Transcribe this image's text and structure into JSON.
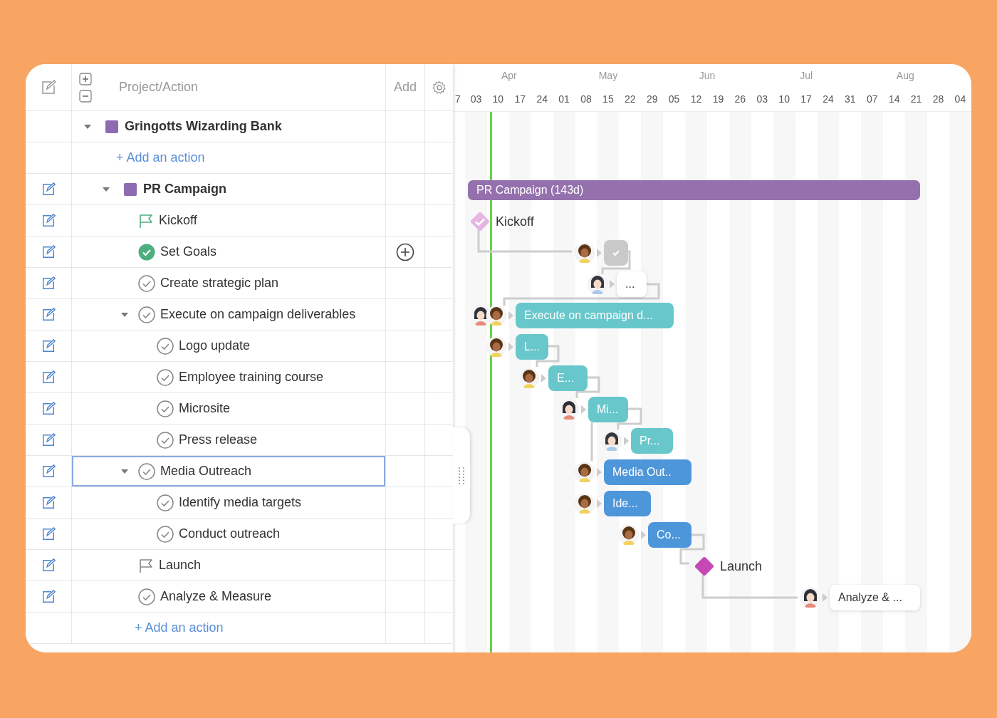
{
  "header": {
    "title": "Project/Action",
    "add": "Add"
  },
  "tree": [
    {
      "kind": "project",
      "label": "Gringotts Wizarding Bank",
      "color": "#8e6bb0",
      "expanded": true,
      "selected": false,
      "editable": false,
      "children": [
        {
          "kind": "add",
          "label": "+ Add an action"
        },
        {
          "kind": "project",
          "label": "PR Campaign",
          "color": "#8e6bb0",
          "expanded": true,
          "selected": false,
          "editable": true,
          "children": [
            {
              "kind": "milestone",
              "label": "Kickoff",
              "done": true,
              "selected": false,
              "editable": true
            },
            {
              "kind": "task",
              "label": "Set Goals",
              "done": true,
              "selected": false,
              "editable": true,
              "add_button": true
            },
            {
              "kind": "task",
              "label": "Create strategic plan",
              "done": false,
              "selected": false,
              "editable": true
            },
            {
              "kind": "task",
              "label": "Execute on campaign deliverables",
              "done": false,
              "expanded": true,
              "selected": false,
              "editable": true,
              "children": [
                {
                  "kind": "task",
                  "label": "Logo update",
                  "done": false,
                  "selected": false,
                  "editable": true
                },
                {
                  "kind": "task",
                  "label": "Employee training course",
                  "done": false,
                  "selected": false,
                  "editable": true
                },
                {
                  "kind": "task",
                  "label": "Microsite",
                  "done": false,
                  "selected": false,
                  "editable": true
                },
                {
                  "kind": "task",
                  "label": "Press release",
                  "done": false,
                  "selected": false,
                  "editable": true
                }
              ]
            },
            {
              "kind": "task",
              "label": "Media Outreach",
              "done": false,
              "expanded": true,
              "selected": true,
              "editable": true,
              "children": [
                {
                  "kind": "task",
                  "label": "Identify media targets",
                  "done": false,
                  "selected": false,
                  "editable": true
                },
                {
                  "kind": "task",
                  "label": "Conduct outreach",
                  "done": false,
                  "selected": false,
                  "editable": true
                }
              ]
            },
            {
              "kind": "milestone",
              "label": "Launch",
              "done": false,
              "selected": false,
              "editable": true
            },
            {
              "kind": "task",
              "label": "Analyze & Measure",
              "done": false,
              "selected": false,
              "editable": true
            },
            {
              "kind": "add",
              "label": "+ Add an action"
            }
          ]
        }
      ]
    }
  ],
  "timeline": {
    "lead_weeks": [
      "7"
    ],
    "months": [
      {
        "label": "Apr",
        "weeks": [
          "03",
          "10",
          "17",
          "24"
        ]
      },
      {
        "label": "May",
        "weeks": [
          "01",
          "08",
          "15",
          "22",
          "29"
        ]
      },
      {
        "label": "Jun",
        "weeks": [
          "05",
          "12",
          "19",
          "26"
        ]
      },
      {
        "label": "Jul",
        "weeks": [
          "03",
          "10",
          "17",
          "24",
          "31"
        ]
      },
      {
        "label": "Aug",
        "weeks": [
          "07",
          "14",
          "21",
          "28"
        ]
      }
    ],
    "trail_weeks": [
      "04"
    ]
  },
  "gantt": [
    {
      "kind": "summary",
      "label": "PR Campaign (143d)",
      "color": "#9470ad"
    },
    {
      "kind": "milestone",
      "label": "Kickoff",
      "color": "#e6b5e1",
      "done": true
    },
    {
      "kind": "done",
      "color": "#c9c9c9",
      "avatars": [
        {
          "kind": "curly"
        }
      ]
    },
    {
      "kind": "card",
      "label": "...",
      "color": "#ffffff",
      "avatars": [
        {
          "kind": "short"
        }
      ]
    },
    {
      "kind": "bar",
      "label": "Execute on campaign d...",
      "color": "#68c7ca",
      "avatars": [
        {
          "kind": "long"
        },
        {
          "kind": "curly"
        }
      ]
    },
    {
      "kind": "bar",
      "label": "L...",
      "color": "#68c7ca",
      "avatars": [
        {
          "kind": "curly"
        }
      ]
    },
    {
      "kind": "bar",
      "label": "E...",
      "color": "#68c7ca",
      "avatars": [
        {
          "kind": "curly"
        }
      ]
    },
    {
      "kind": "bar",
      "label": "Mi...",
      "color": "#68c7ca",
      "avatars": [
        {
          "kind": "long"
        }
      ]
    },
    {
      "kind": "bar",
      "label": "Pr...",
      "color": "#68c7ca",
      "avatars": [
        {
          "kind": "short"
        }
      ]
    },
    {
      "kind": "bar",
      "label": "Media Out..",
      "color": "#4e96da",
      "avatars": [
        {
          "kind": "curly"
        }
      ]
    },
    {
      "kind": "bar",
      "label": "Ide...",
      "color": "#4e96da",
      "avatars": [
        {
          "kind": "curly"
        }
      ]
    },
    {
      "kind": "bar",
      "label": "Co...",
      "color": "#4e96da",
      "avatars": [
        {
          "kind": "curly"
        }
      ]
    },
    {
      "kind": "milestone",
      "label": "Launch",
      "color": "#c548b4",
      "done": false
    },
    {
      "kind": "card",
      "label": "Analyze & ...",
      "color": "#ffffff",
      "avatars": [
        {
          "kind": "long"
        }
      ]
    }
  ]
}
